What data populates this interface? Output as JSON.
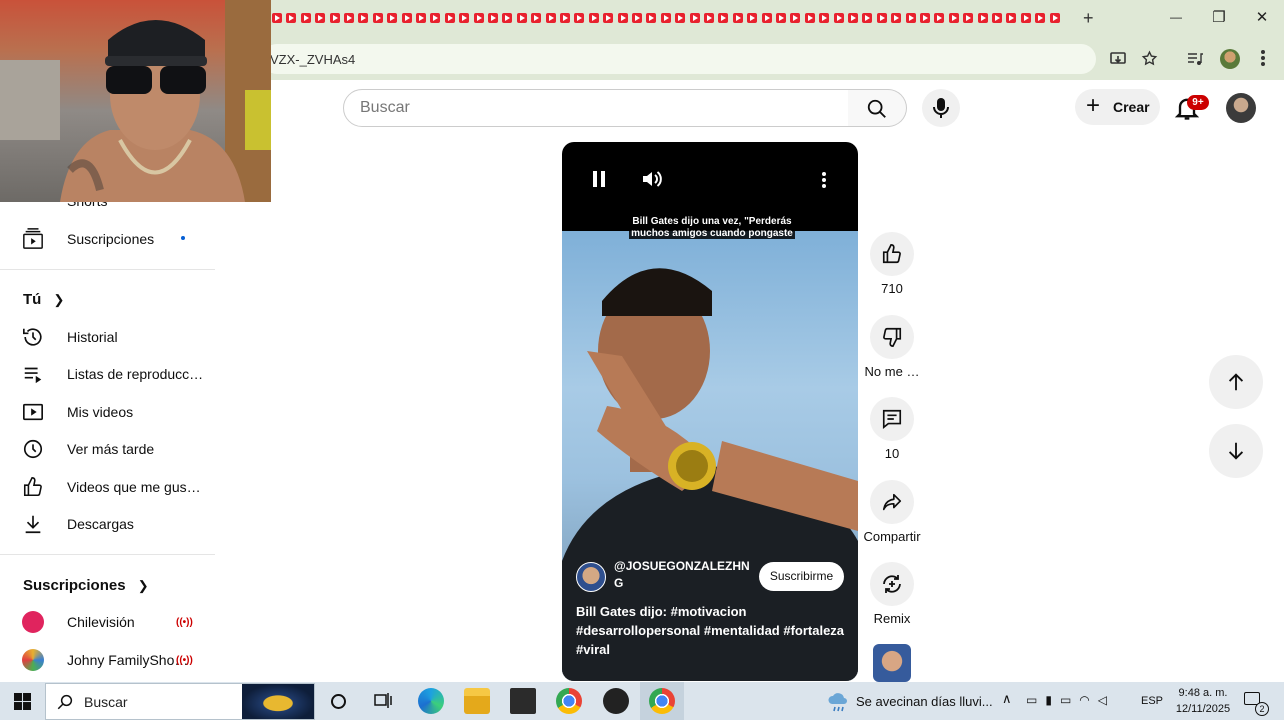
{
  "browser": {
    "url_fragment": "VZX-_ZVHAs4",
    "new_tab": "+",
    "window_controls": {
      "minimize": "—",
      "restore": "❐",
      "close": "✕"
    }
  },
  "header": {
    "search_placeholder": "Buscar",
    "create_label": "Crear",
    "notifications_badge": "9+"
  },
  "sidebar": {
    "top_items": [
      {
        "label": "Shorts",
        "icon": "shorts-icon"
      },
      {
        "label": "Suscripciones",
        "icon": "subscriptions-icon"
      }
    ],
    "you_title": "Tú",
    "you_items": [
      {
        "label": "Historial",
        "icon": "history-icon"
      },
      {
        "label": "Listas de reproducc…",
        "icon": "playlist-icon"
      },
      {
        "label": "Mis videos",
        "icon": "my-videos-icon"
      },
      {
        "label": "Ver más tarde",
        "icon": "watch-later-icon"
      },
      {
        "label": "Videos que me gus…",
        "icon": "liked-videos-icon"
      },
      {
        "label": "Descargas",
        "icon": "download-icon"
      }
    ],
    "subs_title": "Suscripciones",
    "subs_items": [
      {
        "label": "Chilevisión",
        "live": "((•))"
      },
      {
        "label": "Johny FamilySho…",
        "live": "((•))"
      }
    ]
  },
  "short": {
    "caption_line1": "Bill Gates dijo una vez, \"Perderás",
    "caption_line2": "muchos amigos cuando pongaste",
    "channel": "@JOSUEGONZALEZHNG",
    "subscribe_label": "Suscribirme",
    "description": "Bill Gates dijo: #motivacion #desarrollopersonal #mentalidad #fortaleza #viral"
  },
  "actions": {
    "likes": "710",
    "dislike_label": "No me …",
    "comments": "10",
    "share_label": "Compartir",
    "remix_label": "Remix"
  },
  "taskbar": {
    "search_label": "Buscar",
    "weather_text": "Se avecinan días lluvi...",
    "language": "ESP",
    "time": "9:48 a. m.",
    "date": "12/11/2025",
    "notification_count": "2"
  },
  "colors": {
    "youtube_red": "#e8212e",
    "chrome_bar": "#dfe8d6",
    "live_red": "#cc0000"
  }
}
